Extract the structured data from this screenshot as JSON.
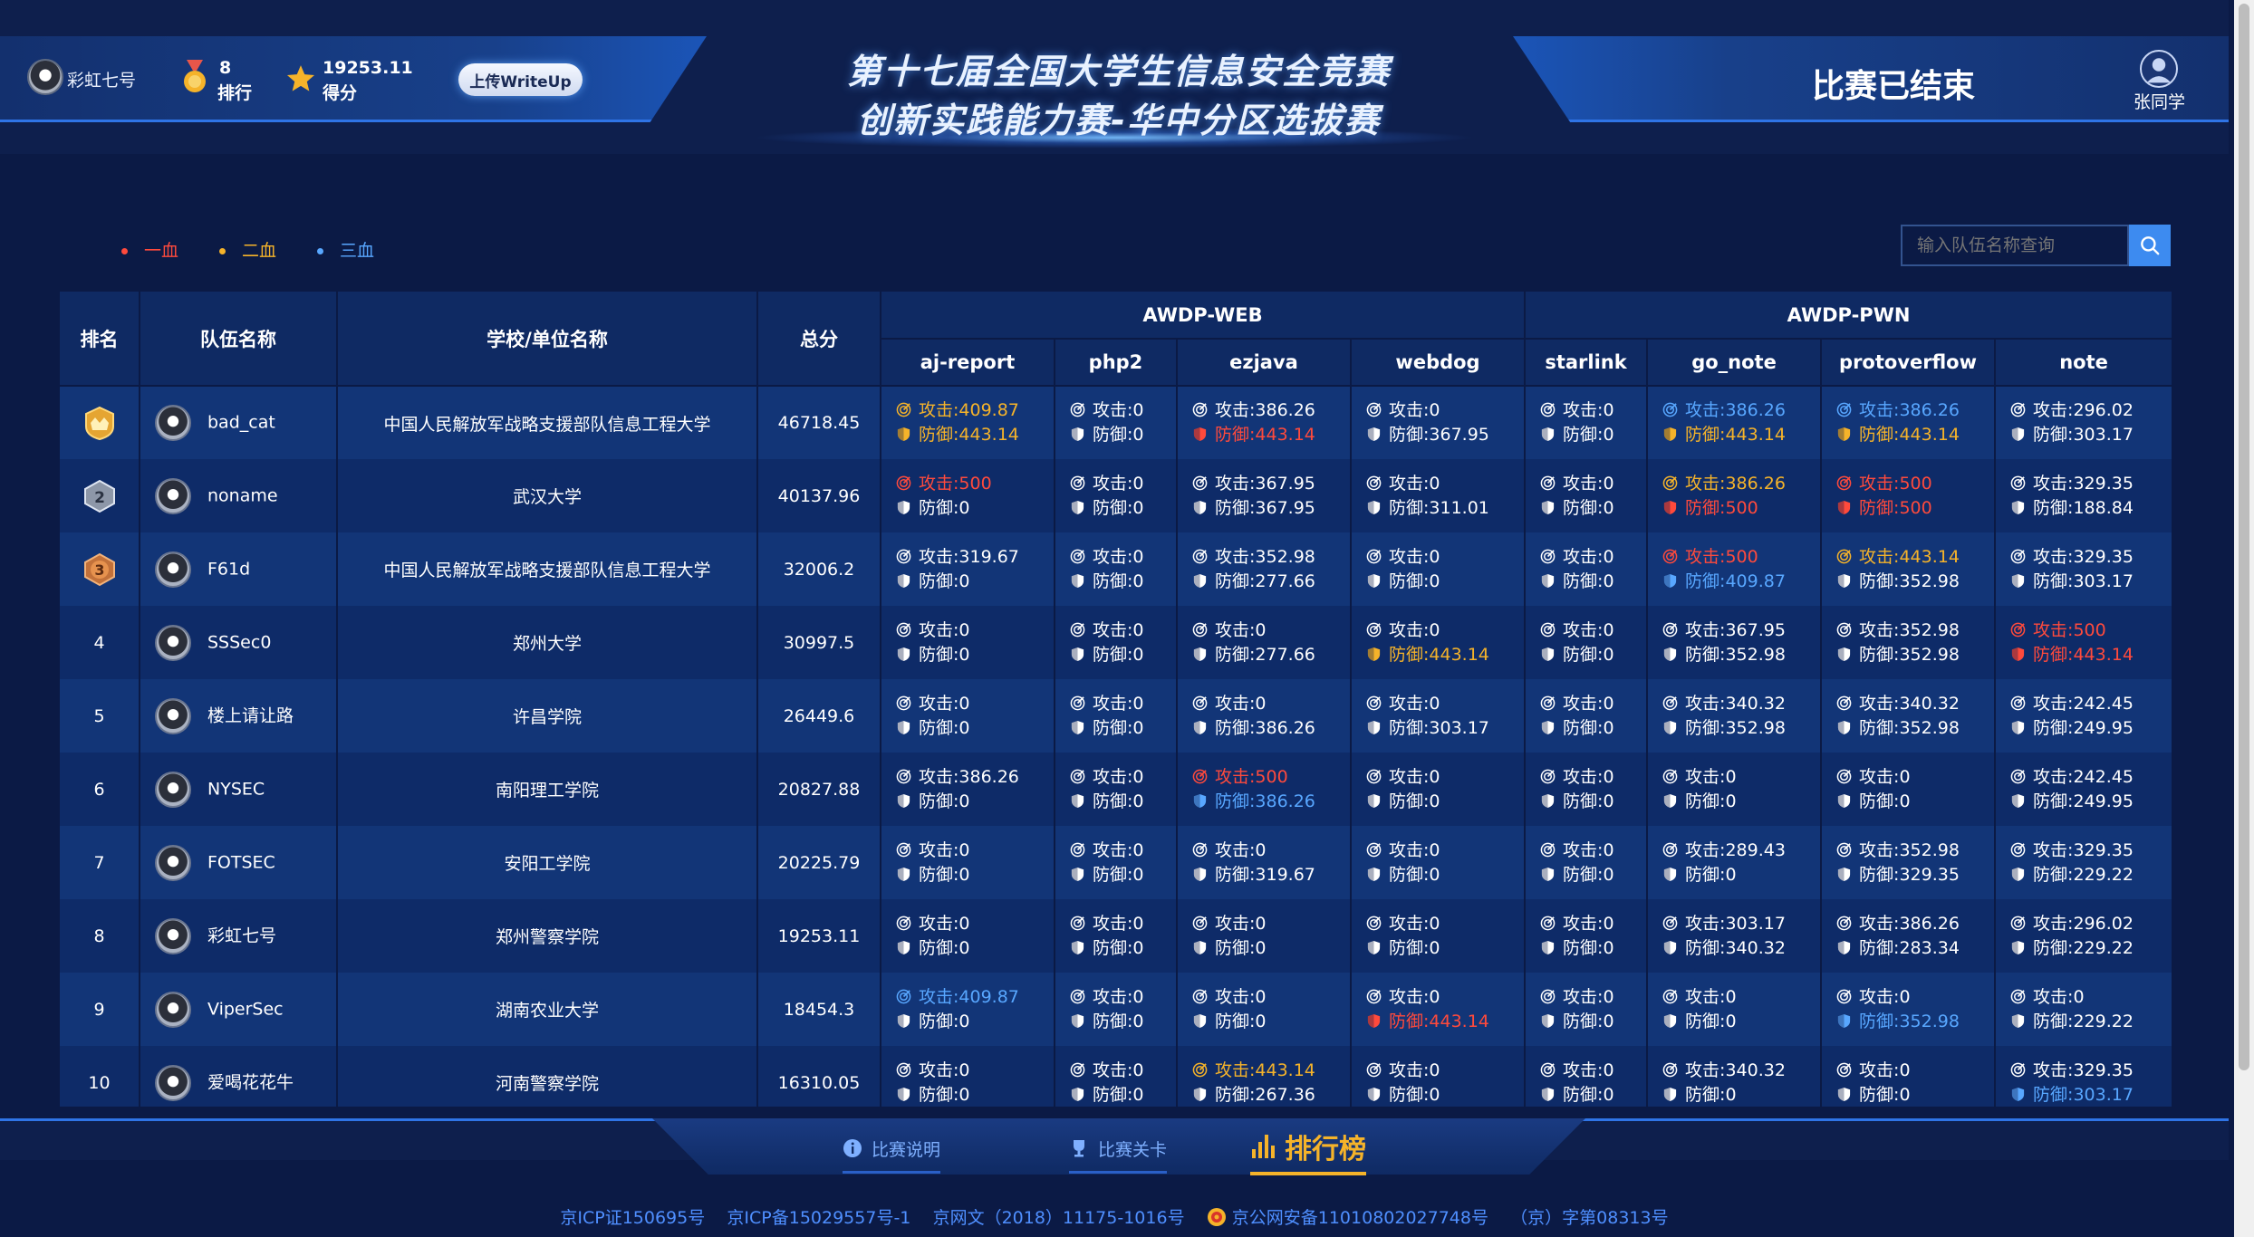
{
  "header": {
    "team_name": "彩虹七号",
    "rank_value": "8",
    "rank_label": "排行",
    "score_value": "19253.11",
    "score_label": "得分",
    "upload_label": "上传WriteUp",
    "title_line1": "第十七届全国大学生信息安全竞赛",
    "title_line2": "创新实践能力赛-华中分区选拔赛",
    "status_text": "比赛已结束",
    "user_name": "张同学"
  },
  "legend": {
    "first_blood": "一血",
    "second_blood": "二血",
    "third_blood": "三血",
    "first_color": "#ff4a3c",
    "second_color": "#f5b32a",
    "third_color": "#58a7ff"
  },
  "search": {
    "placeholder": "输入队伍名称查询"
  },
  "table": {
    "headers": {
      "rank": "排名",
      "team": "队伍名称",
      "school": "学校/单位名称",
      "total": "总分"
    },
    "groups": [
      "AWDP-WEB",
      "AWDP-PWN"
    ],
    "challenges": [
      "aj-report",
      "php2",
      "ezjava",
      "webdog",
      "starlink",
      "go_note",
      "protoverflow",
      "note"
    ],
    "attack_label": "攻击:",
    "defense_label": "防御:",
    "rows": [
      {
        "rank": "1",
        "badge": "gold",
        "team": "bad_cat",
        "school": "中国人民解放军战略支援部队信息工程大学",
        "total": "46718.45",
        "cells": [
          [
            "409.87",
            "yellow",
            "443.14",
            "yellow"
          ],
          [
            "0",
            "white",
            "0",
            "white"
          ],
          [
            "386.26",
            "white",
            "443.14",
            "red"
          ],
          [
            "0",
            "white",
            "367.95",
            "white"
          ],
          [
            "0",
            "white",
            "0",
            "white"
          ],
          [
            "386.26",
            "blue",
            "443.14",
            "yellow"
          ],
          [
            "386.26",
            "blue",
            "443.14",
            "yellow"
          ],
          [
            "296.02",
            "white",
            "303.17",
            "white"
          ]
        ]
      },
      {
        "rank": "2",
        "badge": "silver",
        "team": "noname",
        "school": "武汉大学",
        "total": "40137.96",
        "cells": [
          [
            "500",
            "red",
            "0",
            "white"
          ],
          [
            "0",
            "white",
            "0",
            "white"
          ],
          [
            "367.95",
            "white",
            "367.95",
            "white"
          ],
          [
            "0",
            "white",
            "311.01",
            "white"
          ],
          [
            "0",
            "white",
            "0",
            "white"
          ],
          [
            "386.26",
            "yellow",
            "500",
            "red"
          ],
          [
            "500",
            "red",
            "500",
            "red"
          ],
          [
            "329.35",
            "white",
            "188.84",
            "white"
          ]
        ]
      },
      {
        "rank": "3",
        "badge": "bronze",
        "team": "F61d",
        "school": "中国人民解放军战略支援部队信息工程大学",
        "total": "32006.2",
        "cells": [
          [
            "319.67",
            "white",
            "0",
            "white"
          ],
          [
            "0",
            "white",
            "0",
            "white"
          ],
          [
            "352.98",
            "white",
            "277.66",
            "white"
          ],
          [
            "0",
            "white",
            "0",
            "white"
          ],
          [
            "0",
            "white",
            "0",
            "white"
          ],
          [
            "500",
            "red",
            "409.87",
            "blue"
          ],
          [
            "443.14",
            "yellow",
            "352.98",
            "white"
          ],
          [
            "329.35",
            "white",
            "303.17",
            "white"
          ]
        ]
      },
      {
        "rank": "4",
        "badge": "",
        "team": "SSSec0",
        "school": "郑州大学",
        "total": "30997.5",
        "cells": [
          [
            "0",
            "white",
            "0",
            "white"
          ],
          [
            "0",
            "white",
            "0",
            "white"
          ],
          [
            "0",
            "white",
            "277.66",
            "white"
          ],
          [
            "0",
            "white",
            "443.14",
            "yellow"
          ],
          [
            "0",
            "white",
            "0",
            "white"
          ],
          [
            "367.95",
            "white",
            "352.98",
            "white"
          ],
          [
            "352.98",
            "white",
            "352.98",
            "white"
          ],
          [
            "500",
            "red",
            "443.14",
            "red"
          ]
        ]
      },
      {
        "rank": "5",
        "badge": "",
        "team": "楼上请让路",
        "school": "许昌学院",
        "total": "26449.6",
        "cells": [
          [
            "0",
            "white",
            "0",
            "white"
          ],
          [
            "0",
            "white",
            "0",
            "white"
          ],
          [
            "0",
            "white",
            "386.26",
            "white"
          ],
          [
            "0",
            "white",
            "303.17",
            "white"
          ],
          [
            "0",
            "white",
            "0",
            "white"
          ],
          [
            "340.32",
            "white",
            "352.98",
            "white"
          ],
          [
            "340.32",
            "white",
            "352.98",
            "white"
          ],
          [
            "242.45",
            "white",
            "249.95",
            "white"
          ]
        ]
      },
      {
        "rank": "6",
        "badge": "",
        "team": "NYSEC",
        "school": "南阳理工学院",
        "total": "20827.88",
        "cells": [
          [
            "386.26",
            "white",
            "0",
            "white"
          ],
          [
            "0",
            "white",
            "0",
            "white"
          ],
          [
            "500",
            "red",
            "386.26",
            "blue"
          ],
          [
            "0",
            "white",
            "0",
            "white"
          ],
          [
            "0",
            "white",
            "0",
            "white"
          ],
          [
            "0",
            "white",
            "0",
            "white"
          ],
          [
            "0",
            "white",
            "0",
            "white"
          ],
          [
            "242.45",
            "white",
            "249.95",
            "white"
          ]
        ]
      },
      {
        "rank": "7",
        "badge": "",
        "team": "FOTSEC",
        "school": "安阳工学院",
        "total": "20225.79",
        "cells": [
          [
            "0",
            "white",
            "0",
            "white"
          ],
          [
            "0",
            "white",
            "0",
            "white"
          ],
          [
            "0",
            "white",
            "319.67",
            "white"
          ],
          [
            "0",
            "white",
            "0",
            "white"
          ],
          [
            "0",
            "white",
            "0",
            "white"
          ],
          [
            "289.43",
            "white",
            "0",
            "white"
          ],
          [
            "352.98",
            "white",
            "329.35",
            "white"
          ],
          [
            "329.35",
            "white",
            "229.22",
            "white"
          ]
        ]
      },
      {
        "rank": "8",
        "badge": "",
        "team": "彩虹七号",
        "school": "郑州警察学院",
        "total": "19253.11",
        "cells": [
          [
            "0",
            "white",
            "0",
            "white"
          ],
          [
            "0",
            "white",
            "0",
            "white"
          ],
          [
            "0",
            "white",
            "0",
            "white"
          ],
          [
            "0",
            "white",
            "0",
            "white"
          ],
          [
            "0",
            "white",
            "0",
            "white"
          ],
          [
            "303.17",
            "white",
            "340.32",
            "white"
          ],
          [
            "386.26",
            "white",
            "283.34",
            "white"
          ],
          [
            "296.02",
            "white",
            "229.22",
            "white"
          ]
        ]
      },
      {
        "rank": "9",
        "badge": "",
        "team": "ViperSec",
        "school": "湖南农业大学",
        "total": "18454.3",
        "cells": [
          [
            "409.87",
            "blue",
            "0",
            "white"
          ],
          [
            "0",
            "white",
            "0",
            "white"
          ],
          [
            "0",
            "white",
            "0",
            "white"
          ],
          [
            "0",
            "white",
            "443.14",
            "red"
          ],
          [
            "0",
            "white",
            "0",
            "white"
          ],
          [
            "0",
            "white",
            "0",
            "white"
          ],
          [
            "0",
            "white",
            "352.98",
            "blue"
          ],
          [
            "0",
            "white",
            "229.22",
            "white"
          ]
        ]
      },
      {
        "rank": "10",
        "badge": "",
        "team": "爱喝花花牛",
        "school": "河南警察学院",
        "total": "16310.05",
        "cells": [
          [
            "0",
            "white",
            "0",
            "white"
          ],
          [
            "0",
            "white",
            "0",
            "white"
          ],
          [
            "443.14",
            "yellow",
            "267.36",
            "white"
          ],
          [
            "0",
            "white",
            "0",
            "white"
          ],
          [
            "0",
            "white",
            "0",
            "white"
          ],
          [
            "340.32",
            "white",
            "0",
            "white"
          ],
          [
            "0",
            "white",
            "0",
            "white"
          ],
          [
            "329.35",
            "white",
            "303.17",
            "blue"
          ]
        ]
      }
    ]
  },
  "nav": {
    "tab_info": "比赛说明",
    "tab_levels": "比赛关卡",
    "tab_rank": "排行榜"
  },
  "footer": {
    "icp1": "京ICP证150695号",
    "icp2": "京ICP备15029557号-1",
    "wenwang": "京网文（2018）11175-1016号",
    "gongan": "京公网安备11010802027748号",
    "zi": "（京）字第08313号"
  }
}
